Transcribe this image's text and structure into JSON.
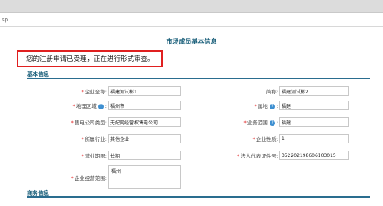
{
  "breadcrumb": "sp",
  "page": {
    "title": "市场成员基本信息",
    "notice": "您的注册申请已受理，正在进行形式审查。"
  },
  "sections": {
    "basic": "基本信息",
    "business": "商务信息"
  },
  "form": {
    "company_name": {
      "label": "企业全称",
      "value": "福建测试彬1"
    },
    "short_name": {
      "label": "简称",
      "value": "福建测试彬2"
    },
    "region": {
      "label": "地理区域",
      "value": "福州市"
    },
    "location": {
      "label": "属地",
      "value": "福建"
    },
    "sales_type": {
      "label": "售电公司类型",
      "value": "无配网经营权售电公司"
    },
    "business_scope": {
      "label": "业务范围",
      "value": "福建"
    },
    "industry": {
      "label": "所属行业",
      "value": "其他企业"
    },
    "company_nature": {
      "label": "企业性质",
      "value": "1"
    },
    "term": {
      "label": "营业期限",
      "value": "长期"
    },
    "legal_id": {
      "label": "法人代表证件号",
      "value": "352202198606103015"
    },
    "scope": {
      "label": "企业经营范围",
      "value": "福州"
    }
  },
  "colors": {
    "accent": "#1a5f7a",
    "required": "#e02020",
    "notice_border": "#e02020",
    "help_icon": "#3d8fd1"
  },
  "icons": {
    "help": "question-circle-icon"
  }
}
